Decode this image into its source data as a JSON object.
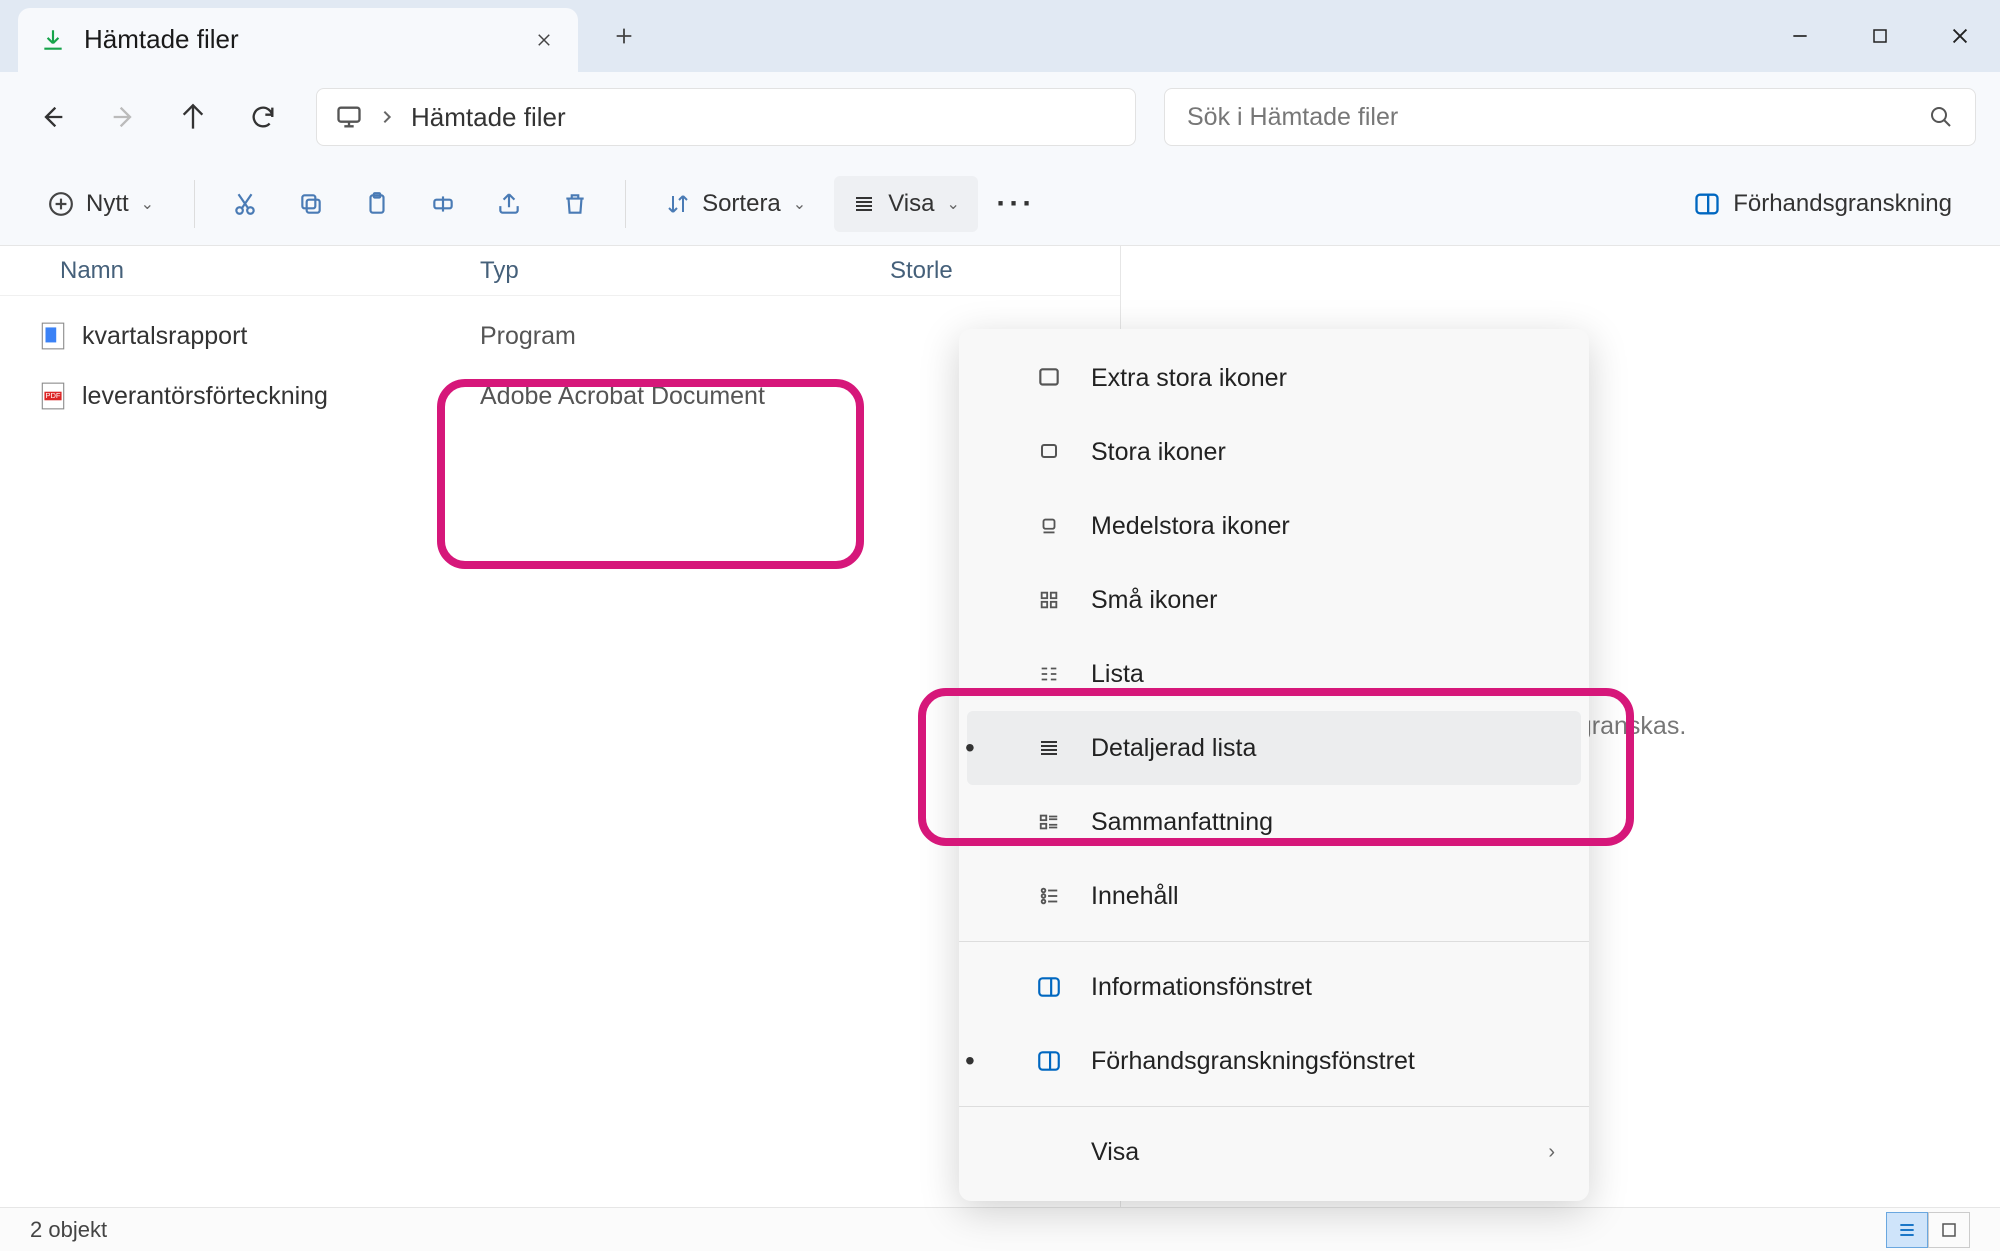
{
  "window": {
    "tab_title": "Hämtade filer",
    "breadcrumb": "Hämtade filer",
    "search_placeholder": "Sök i Hämtade filer"
  },
  "toolbar": {
    "new_label": "Nytt",
    "sort_label": "Sortera",
    "view_label": "Visa",
    "preview_label": "Förhandsgranskning"
  },
  "columns": {
    "name": "Namn",
    "type": "Typ",
    "size": "Storle"
  },
  "files": [
    {
      "name": "kvartalsrapport",
      "type": "Program",
      "icon": "app"
    },
    {
      "name": "leverantörsförteckning",
      "type": "Adobe Acrobat Document",
      "icon": "pdf"
    }
  ],
  "preview_pane_text": "ska förhandsgranskas.",
  "view_menu": {
    "items": [
      {
        "label": "Extra stora ikoner",
        "icon": "xl-icons",
        "selected": false
      },
      {
        "label": "Stora ikoner",
        "icon": "lg-icons",
        "selected": false
      },
      {
        "label": "Medelstora ikoner",
        "icon": "md-icons",
        "selected": false
      },
      {
        "label": "Små ikoner",
        "icon": "sm-icons",
        "selected": false
      },
      {
        "label": "Lista",
        "icon": "list",
        "selected": false
      },
      {
        "label": "Detaljerad lista",
        "icon": "details",
        "selected": true,
        "highlighted": true
      },
      {
        "label": "Sammanfattning",
        "icon": "tiles",
        "selected": false
      },
      {
        "label": "Innehåll",
        "icon": "content",
        "selected": false
      }
    ],
    "panes": [
      {
        "label": "Informationsfönstret",
        "icon": "info-pane",
        "selected": false
      },
      {
        "label": "Förhandsgranskningsfönstret",
        "icon": "preview-pane",
        "selected": true
      }
    ],
    "show_label": "Visa"
  },
  "status": {
    "text": "2 objekt"
  },
  "icons": {
    "download": "download-icon",
    "close": "close-icon",
    "plus": "plus-icon",
    "minimize": "minimize-icon",
    "maximize": "maximize-icon",
    "win-close": "window-close-icon",
    "back": "back-icon",
    "forward": "forward-icon",
    "up": "up-icon",
    "refresh": "refresh-icon",
    "monitor": "monitor-icon",
    "chevron-right": "chevron-right-icon",
    "search": "search-icon",
    "cut": "cut-icon",
    "copy": "copy-icon",
    "paste": "paste-icon",
    "rename": "rename-icon",
    "share": "share-icon",
    "delete": "delete-icon",
    "sort": "sort-icon",
    "view-lines": "view-lines-icon",
    "more": "more-icon",
    "split": "split-icon"
  }
}
